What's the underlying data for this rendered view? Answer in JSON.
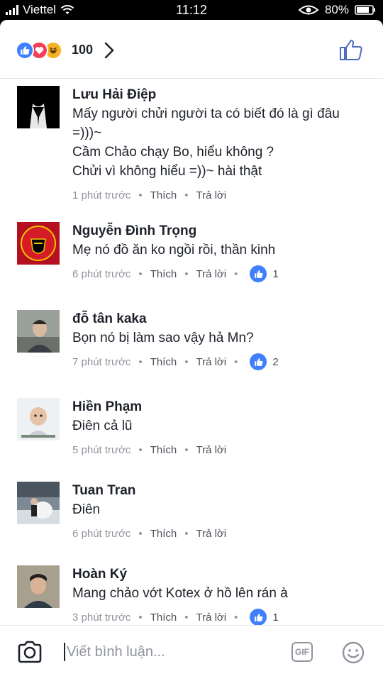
{
  "status_bar": {
    "carrier": "Viettel",
    "time": "11:12",
    "battery": "80%"
  },
  "reactions": {
    "count": "100",
    "icons": [
      "like-icon",
      "love-icon",
      "haha-icon"
    ],
    "colors": {
      "like": "#4080ff",
      "love": "#f33e58",
      "haha": "#f7b125"
    }
  },
  "comments": [
    {
      "name": "Lưu Hải Điệp",
      "text": "Mấy người chửi người ta có biết đó là gì đâu\n=)))~\nCầm Chảo chạy Bo, hiểu không ?\nChửi vì không hiểu =))~ hài thật",
      "time": "1 phút trước",
      "like_label": "Thích",
      "reply_label": "Trả lời",
      "likes": ""
    },
    {
      "name": "Nguyễn Đình Trọng",
      "text": "Mẹ nó đồ ăn ko ngồi rồi, thần kinh",
      "time": "6 phút trước",
      "like_label": "Thích",
      "reply_label": "Trả lời",
      "likes": "1"
    },
    {
      "name": "đỗ tân kaka",
      "text": "Bọn nó bị làm sao vậy hả Mn?",
      "time": "7 phút trước",
      "like_label": "Thích",
      "reply_label": "Trả lời",
      "likes": "2"
    },
    {
      "name": "Hiền Phạm",
      "text": "Điên cả lũ",
      "time": "5 phút trước",
      "like_label": "Thích",
      "reply_label": "Trả lời",
      "likes": ""
    },
    {
      "name": "Tuan Tran",
      "text": "Điên",
      "time": "6 phút trước",
      "like_label": "Thích",
      "reply_label": "Trả lời",
      "likes": ""
    },
    {
      "name": "Hoàn Ký",
      "text": "Mang chảo vớt Kotex ở hồ lên rán à",
      "time": "3 phút trước",
      "like_label": "Thích",
      "reply_label": "Trả lời",
      "likes": "1"
    }
  ],
  "composer": {
    "placeholder": "Viết bình luận...",
    "gif_label": "GIF"
  }
}
